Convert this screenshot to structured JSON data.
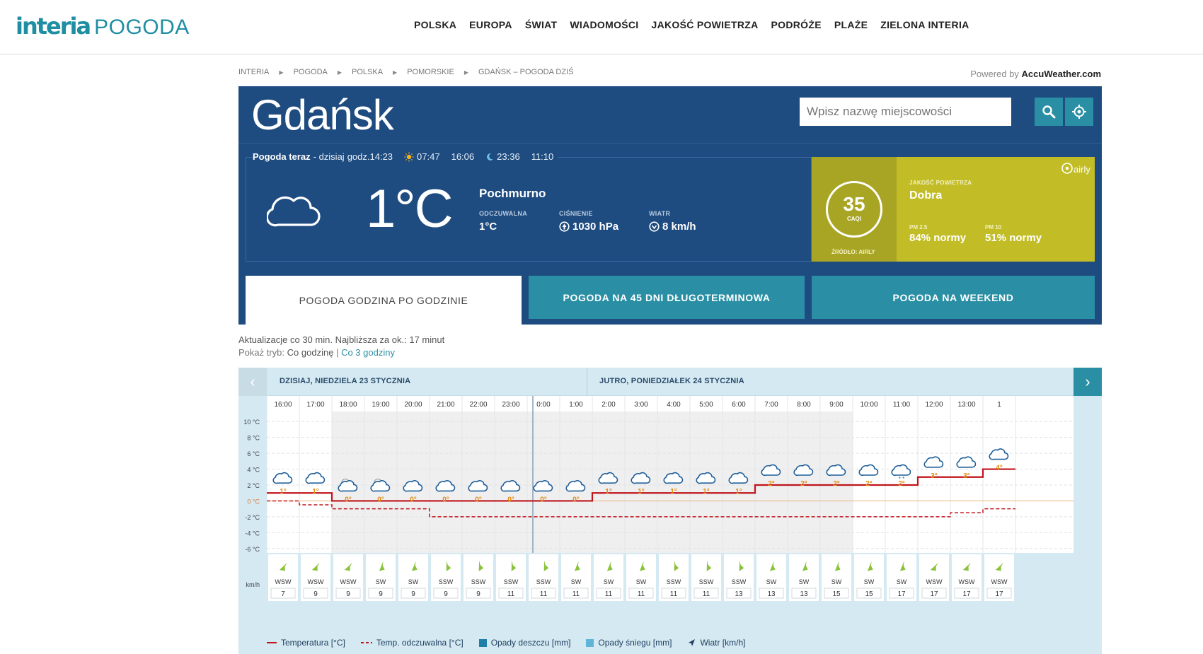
{
  "header": {
    "logo_brand": "interia",
    "logo_section": "POGODA",
    "nav": [
      "POLSKA",
      "EUROPA",
      "ŚWIAT",
      "WIADOMOŚCI",
      "JAKOŚĆ POWIETRZA",
      "PODRÓŻE",
      "PLAŻE",
      "ZIELONA INTERIA"
    ]
  },
  "breadcrumb": [
    "INTERIA",
    "POGODA",
    "POLSKA",
    "POMORSKIE",
    "GDAŃSK – POGODA DZIŚ"
  ],
  "powered": {
    "prefix": "Powered by",
    "brand": "AccuWeather.com"
  },
  "city": "Gdańsk",
  "search": {
    "placeholder": "Wpisz nazwę miejscowości"
  },
  "now": {
    "title": "Pogoda teraz",
    "sep": "- dzisiaj",
    "time": "godz.14:23",
    "sunrise": "07:47",
    "sunset": "16:06",
    "moonrise": "23:36",
    "moonset": "11:10",
    "icon": "cloud-icon",
    "temperature": "1°C",
    "description": "Pochmurno",
    "feels_label": "ODCZUWALNA",
    "feels_value": "1°C",
    "pressure_label": "CIŚNIENIE",
    "pressure_value": "1030 hPa",
    "wind_label": "WIATR",
    "wind_value": "8 km/h"
  },
  "air_quality": {
    "value": "35",
    "unit": "CAQI",
    "source": "ŹRÓDŁO: AIRLY",
    "label": "JAKOŚĆ POWIETRZA",
    "status": "Dobra",
    "pm25_label": "PM 2.5",
    "pm25_value": "84% normy",
    "pm10_label": "PM 10",
    "pm10_value": "51% normy",
    "brand": "airly",
    "color": "#c2bd26"
  },
  "tabs": [
    "POGODA GODZINA PO GODZINIE",
    "POGODA NA 45 DNI DŁUGOTERMINOWA",
    "POGODA NA WEEKEND"
  ],
  "update_text": "Aktualizacje co 30 min. Najbliższa za ok.: 17 minut",
  "mode": {
    "label": "Pokaż tryb:",
    "current": "Co godzinę",
    "sep": "|",
    "alt": "Co 3 godziny"
  },
  "forecast": {
    "day1": "DZISIAJ, NIEDZIELA 23 STYCZNIA",
    "day2": "JUTRO, PONIEDZIAŁEK 24 STYCZNIA",
    "wind_unit": "km/h",
    "hours": [
      "16:00",
      "17:00",
      "18:00",
      "19:00",
      "20:00",
      "21:00",
      "22:00",
      "23:00",
      "0:00",
      "1:00",
      "2:00",
      "3:00",
      "4:00",
      "5:00",
      "6:00",
      "7:00",
      "8:00",
      "9:00",
      "10:00",
      "11:00",
      "12:00",
      "13:00",
      "1"
    ],
    "temps": [
      1,
      1,
      0,
      0,
      0,
      0,
      0,
      0,
      0,
      0,
      1,
      1,
      1,
      1,
      1,
      2,
      2,
      2,
      2,
      2,
      3,
      3,
      4
    ],
    "temp_labels": [
      "1°",
      "1°",
      "0°",
      "0°",
      "0°",
      "0°",
      "0°",
      "0°",
      "0°",
      "0°",
      "1°",
      "1°",
      "1°",
      "1°",
      "1°",
      "2°",
      "2°",
      "2°",
      "2°",
      "2°",
      "3°",
      "3°",
      "4°"
    ],
    "feels": [
      0,
      -0.5,
      -1,
      -1,
      -1,
      -2,
      -2,
      -2,
      -2,
      -2,
      -2,
      -2,
      -2,
      -2,
      -2,
      -2,
      -2,
      -2,
      -2,
      -2,
      -2,
      -1.5,
      -1
    ],
    "icons": [
      "cloud",
      "cloud",
      "night-cloud",
      "night-cloud",
      "cloud",
      "cloud",
      "cloud",
      "cloud",
      "cloud",
      "cloud",
      "cloud",
      "cloud",
      "cloud",
      "cloud",
      "cloud",
      "cloud",
      "cloud",
      "cloud",
      "cloud",
      "snow-cloud",
      "cloud",
      "cloud",
      "cloud"
    ],
    "wind_dirs": [
      "WSW",
      "WSW",
      "WSW",
      "SW",
      "SW",
      "SSW",
      "SSW",
      "SSW",
      "SSW",
      "SW",
      "SW",
      "SW",
      "SSW",
      "SSW",
      "SSW",
      "SW",
      "SW",
      "SW",
      "SW",
      "SW",
      "WSW",
      "WSW",
      "WSW"
    ],
    "wind_speeds": [
      "7",
      "9",
      "9",
      "9",
      "9",
      "9",
      "9",
      "11",
      "11",
      "11",
      "11",
      "11",
      "11",
      "11",
      "13",
      "13",
      "13",
      "15",
      "15",
      "17",
      "17",
      "17",
      "17"
    ],
    "y_ticks": [
      "10 °C",
      "8 °C",
      "6 °C",
      "4 °C",
      "2 °C",
      "0 °C",
      "-2 °C",
      "-4 °C",
      "-6 °C"
    ]
  },
  "chart_data": {
    "type": "line",
    "x": [
      "16:00",
      "17:00",
      "18:00",
      "19:00",
      "20:00",
      "21:00",
      "22:00",
      "23:00",
      "0:00",
      "1:00",
      "2:00",
      "3:00",
      "4:00",
      "5:00",
      "6:00",
      "7:00",
      "8:00",
      "9:00",
      "10:00",
      "11:00",
      "12:00",
      "13:00",
      "1"
    ],
    "series": [
      {
        "name": "Temperatura [°C]",
        "values": [
          1,
          1,
          0,
          0,
          0,
          0,
          0,
          0,
          0,
          0,
          1,
          1,
          1,
          1,
          1,
          2,
          2,
          2,
          2,
          2,
          3,
          3,
          4
        ]
      },
      {
        "name": "Temp. odczuwalna [°C]",
        "values": [
          0,
          -0.5,
          -1,
          -1,
          -1,
          -2,
          -2,
          -2,
          -2,
          -2,
          -2,
          -2,
          -2,
          -2,
          -2,
          -2,
          -2,
          -2,
          -2,
          -2,
          -2,
          -1.5,
          -1
        ]
      }
    ],
    "ylim": [
      -7,
      11
    ],
    "ylabel": "",
    "xlabel": "",
    "grid": true,
    "legend_position": "bottom"
  },
  "legend": {
    "temp": "Temperatura [°C]",
    "feels": "Temp. odczuwalna [°C]",
    "rain": "Opady deszczu [mm]",
    "snow": "Opady śniegu [mm]",
    "wind": "Wiatr [km/h]"
  },
  "colors": {
    "brand": "#1f8ea3",
    "panel": "#1e4c80",
    "accent": "#2a8fa4",
    "temp_line": "#c0141b",
    "air_quality": "#c2bd26"
  }
}
